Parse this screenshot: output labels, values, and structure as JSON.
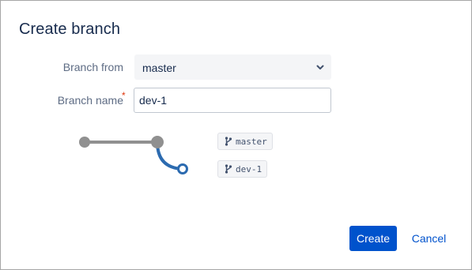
{
  "dialog": {
    "title": "Create branch"
  },
  "form": {
    "branch_from_label": "Branch from",
    "branch_from_value": "master",
    "branch_name_label": "Branch name",
    "required_marker": "*",
    "branch_name_value": "dev-1"
  },
  "diagram": {
    "source_tag": "master",
    "new_tag": "dev-1",
    "icon": "branch-icon"
  },
  "actions": {
    "create_label": "Create",
    "cancel_label": "Cancel"
  },
  "colors": {
    "primary": "#0052cc",
    "trunk": "#909090",
    "branch": "#2c6bb0"
  }
}
